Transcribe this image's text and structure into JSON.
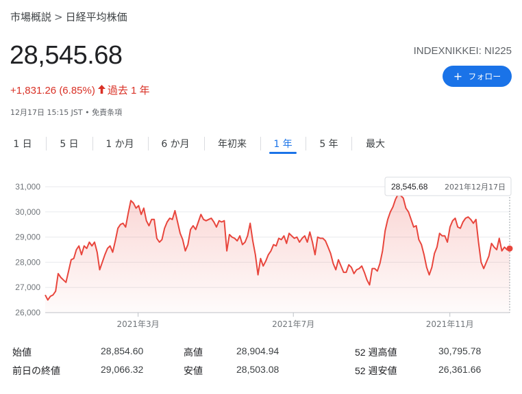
{
  "breadcrumb": {
    "parent": "市場概説",
    "separator": ">",
    "current": "日経平均株価"
  },
  "quote": {
    "price": "28,545.68",
    "change": "+1,831.26 (6.85%)",
    "period": "過去 1 年",
    "meta": "12月17日 15:15 JST • 免責条項",
    "ticker": "INDEXNIKKEI: NI225",
    "follow_label": "フォロー"
  },
  "tabs": [
    {
      "label": "1 日",
      "active": false
    },
    {
      "label": "5 日",
      "active": false
    },
    {
      "label": "1 か月",
      "active": false
    },
    {
      "label": "6 か月",
      "active": false
    },
    {
      "label": "年初来",
      "active": false
    },
    {
      "label": "1 年",
      "active": true
    },
    {
      "label": "5 年",
      "active": false
    },
    {
      "label": "最大",
      "active": false
    }
  ],
  "colors": {
    "line": "#e8453c",
    "accent": "#1a73e8",
    "negative": "#d93025"
  },
  "chart_data": {
    "type": "area",
    "title": "",
    "xlabel": "",
    "ylabel": "",
    "ylim": [
      26000,
      31000
    ],
    "yticks": [
      "31,000",
      "30,000",
      "29,000",
      "28,000",
      "27,000",
      "26,000"
    ],
    "ytick_values": [
      31000,
      30000,
      29000,
      28000,
      27000,
      26000
    ],
    "xticks": [
      "2021年3月",
      "2021年7月",
      "2021年11月"
    ],
    "xtick_days": [
      73,
      195,
      318
    ],
    "x_days_total": 365,
    "series": [
      {
        "values": [
          26700,
          26500,
          26650,
          26700,
          26850,
          27550,
          27400,
          27300,
          27200,
          27650,
          28100,
          28150,
          28500,
          28650,
          28300,
          28650,
          28550,
          28800,
          28650,
          28800,
          28400,
          27700,
          28000,
          28300,
          28550,
          28650,
          28400,
          28850,
          29350,
          29500,
          29550,
          29400,
          29950,
          30450,
          30350,
          30150,
          30250,
          29900,
          30150,
          29650,
          29450,
          29700,
          29700,
          28950,
          28800,
          28900,
          29350,
          29600,
          29750,
          29700,
          30050,
          29600,
          29150,
          28900,
          28450,
          28700,
          29300,
          29450,
          29300,
          29600,
          29900,
          29700,
          29650,
          29700,
          29750,
          29600,
          29400,
          29650,
          29600,
          29650,
          28450,
          29100,
          29000,
          28950,
          28850,
          29050,
          28700,
          28800,
          29050,
          29550,
          28850,
          28300,
          27500,
          28150,
          27850,
          28050,
          28300,
          28450,
          28700,
          28650,
          28950,
          28900,
          29050,
          28750,
          29150,
          29050,
          28950,
          29000,
          28800,
          28950,
          29050,
          28800,
          29200,
          28800,
          28300,
          29000,
          28950,
          28950,
          28850,
          28600,
          28350,
          27950,
          27700,
          28100,
          27850,
          27600,
          27600,
          27900,
          27800,
          27550,
          27700,
          27750,
          27850,
          27600,
          27300,
          27100,
          27750,
          27750,
          27650,
          27950,
          28450,
          29250,
          29700,
          30000,
          30200,
          30500,
          30700,
          30650,
          30550,
          30150,
          30000,
          29700,
          29400,
          29450,
          28900,
          28700,
          28300,
          27800,
          27500,
          27800,
          28350,
          28600,
          29150,
          29050,
          29050,
          28800,
          29400,
          29650,
          29750,
          29400,
          29350,
          29600,
          29750,
          29800,
          29700,
          29550,
          29700,
          28800,
          28000,
          27750,
          28000,
          28250,
          28750,
          28600,
          28500,
          28950,
          28450,
          28600,
          28500,
          28545.68
        ]
      }
    ],
    "tooltip": {
      "value": "28,545.68",
      "date": "2021年12月17日"
    }
  },
  "stats": [
    {
      "label": "始値",
      "value": "28,854.60"
    },
    {
      "label": "前日の終値",
      "value": "29,066.32"
    },
    {
      "label": "高値",
      "value": "28,904.94"
    },
    {
      "label": "安値",
      "value": "28,503.08"
    },
    {
      "label": "52 週高値",
      "value": "30,795.78"
    },
    {
      "label": "52 週安値",
      "value": "26,361.66"
    }
  ]
}
